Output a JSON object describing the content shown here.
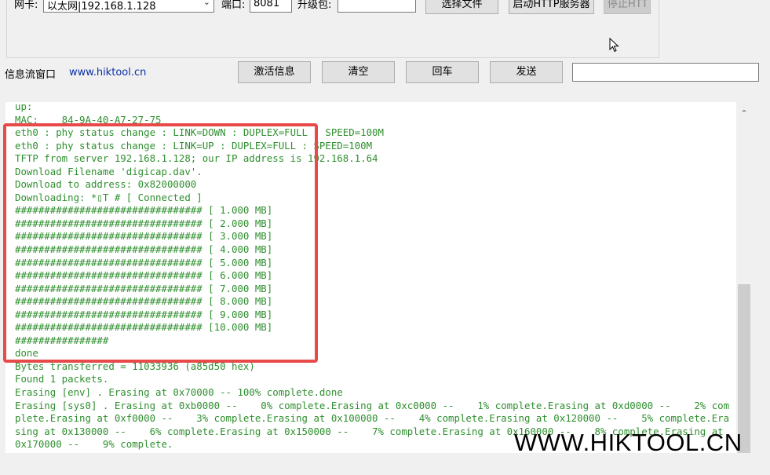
{
  "top_row": {
    "nic_label": "网卡:",
    "nic_value": "以太网|192.168.1.128",
    "port_label": "端口:",
    "port_value": "8081",
    "package_label": "升级包:",
    "package_value": "",
    "select_file_button": "选择文件",
    "start_http_button": "启动HTTP服务器",
    "stop_http_button": "停止HTT"
  },
  "info_row": {
    "log_window_label": "信息流窗口",
    "website_link": "www.hiktool.cn",
    "activate_button": "激活信息",
    "clear_button": "清空",
    "enter_button": "回车",
    "send_button": "发送",
    "send_input_value": ""
  },
  "console": {
    "lines": [
      "up:",
      "MAC:    84-9A-40-A7-27-75",
      "eth0 : phy status change : LINK=DOWN : DUPLEX=FULL : SPEED=100M",
      "eth0 : phy status change : LINK=UP : DUPLEX=FULL : SPEED=100M",
      "TFTP from server 192.168.1.128; our IP address is 192.168.1.64",
      "Download Filename 'digicap.dav'.",
      "Download to address: 0x82000000",
      "Downloading: *▯T # [ Connected ]",
      "################################ [ 1.000 MB]",
      "################################ [ 2.000 MB]",
      "################################ [ 3.000 MB]",
      "################################ [ 4.000 MB]",
      "################################ [ 5.000 MB]",
      "################################ [ 6.000 MB]",
      "################################ [ 7.000 MB]",
      "################################ [ 8.000 MB]",
      "################################ [ 9.000 MB]",
      "################################ [10.000 MB]",
      "################",
      "done",
      "Bytes transferred = 11033936 (a85d50 hex)",
      "Found 1 packets.",
      "Erasing [env] . Erasing at 0x70000 -- 100% complete.done",
      "Erasing [sys0] . Erasing at 0xb0000 --    0% complete.Erasing at 0xc0000 --    1% complete.Erasing at 0xd0000 --    2% com",
      "plete.Erasing at 0xf0000 --    3% complete.Erasing at 0x100000 --    4% complete.Erasing at 0x120000 --    5% complete.Era",
      "sing at 0x130000 --    6% complete.Erasing at 0x150000 --    7% complete.Erasing at 0x160000 --    8% complete.Erasing at",
      "0x170000 --    9% complete."
    ],
    "text_color": "#2f8f2f"
  },
  "watermark": "WWW.HIKTOOL.CN",
  "colors": {
    "highlight_border": "#e84a4a",
    "link": "#0b2fa8"
  }
}
